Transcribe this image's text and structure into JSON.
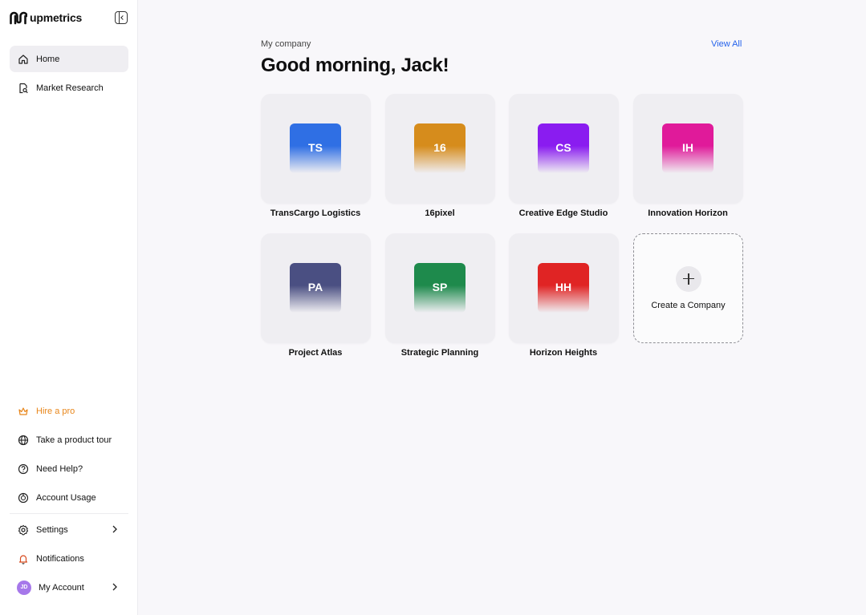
{
  "brand": {
    "name": "upmetrics"
  },
  "sidebar": {
    "top_items": [
      {
        "label": "Home",
        "icon": "home-icon",
        "active": true
      },
      {
        "label": "Market Research",
        "icon": "document-search-icon",
        "active": false
      }
    ],
    "bottom_items": [
      {
        "label": "Hire a pro",
        "icon": "crown-icon"
      },
      {
        "label": "Take a product tour",
        "icon": "globe-icon"
      },
      {
        "label": "Need Help?",
        "icon": "help-circle-icon"
      },
      {
        "label": "Account Usage",
        "icon": "usage-icon"
      },
      {
        "label": "Settings",
        "icon": "gear-icon"
      },
      {
        "label": "Notifications",
        "icon": "bell-icon"
      },
      {
        "label": "My Account",
        "icon": "avatar",
        "avatar_initials": "JD"
      }
    ]
  },
  "main": {
    "eyebrow": "My company",
    "view_all": "View All",
    "greeting": "Good morning, Jack!",
    "companies": [
      {
        "initials": "TS",
        "name": "TransCargo Logistics",
        "color": "#2f6fe4"
      },
      {
        "initials": "16",
        "name": "16pixel",
        "color": "#d68c1c"
      },
      {
        "initials": "CS",
        "name": "Creative Edge Studio",
        "color": "#8a1cf0"
      },
      {
        "initials": "IH",
        "name": "Innovation Horizon",
        "color": "#e01a9a"
      },
      {
        "initials": "PA",
        "name": "Project Atlas",
        "color": "#4a4f82"
      },
      {
        "initials": "SP",
        "name": "Strategic Planning",
        "color": "#1e8a4c"
      },
      {
        "initials": "HH",
        "name": "Horizon Heights",
        "color": "#e02424"
      }
    ],
    "create_label": "Create a Company"
  },
  "colors": {
    "accent": "#2563eb",
    "hire": "#e8861a",
    "avatar": "#a678ea"
  }
}
